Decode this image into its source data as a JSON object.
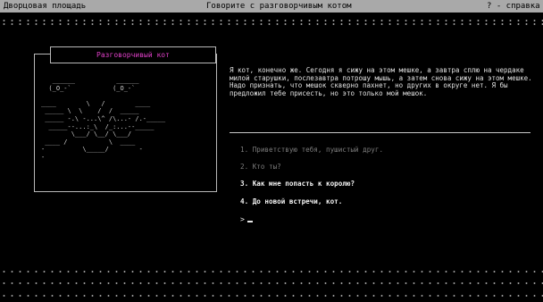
{
  "header": {
    "location": "Дворцовая площадь",
    "title": "Говорите с разговорчивым котом",
    "help": "? - справка"
  },
  "portrait": {
    "name": "Разговорчивый кот",
    "art": "   ______           ______\n  (_O_-`           (_O_-`\n\n____        \\   /        ____\n _____ \\  \\    /  /  _____\n _____ -.\\ -...\\^ /\\...- /.-_____\n  _____--...:_\\  /_:...--_____\n        \\___/ \\__/ \\___/\n ____ /           \\  ____\n-          \\_____/        -\n-"
  },
  "dialog": {
    "speech": "Я кот, конечно же. Сегодня я сижу на этом мешке, а завтра сплю на чердаке милой старушки, послезавтра потрошу мышь, а затем снова сижу на этом мешке. Надо признать, что мешок скверно пахнет, но других в округе нет. Я бы предложил тебе присесть, но это только мой мешок.",
    "options": [
      {
        "label": "1. Приветствую тебя, пушистый друг.",
        "state": "seen"
      },
      {
        "label": "2. Кто ты?",
        "state": "seen"
      },
      {
        "label": "3. Как мне попасть к королю?",
        "state": "new"
      },
      {
        "label": "4. До новой встречи, кот.",
        "state": "new"
      }
    ],
    "prompt": ">"
  },
  "colors": {
    "header_bg": "#a9a9a9",
    "portrait_title": "#e040c8",
    "option_seen": "#7c7c7c",
    "option_new": "#f2f2f2"
  }
}
